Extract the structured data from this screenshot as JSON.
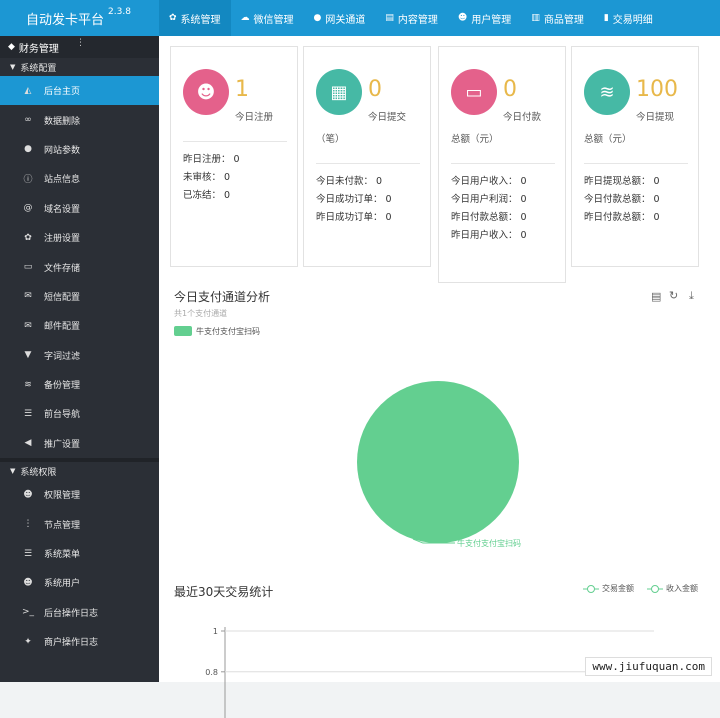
{
  "app": {
    "title": "自动发卡平台",
    "version": "2.3.8"
  },
  "nav": [
    {
      "icon": "gear-icon",
      "glyph": "✿",
      "label": "系统管理",
      "active": true
    },
    {
      "icon": "wechat-icon",
      "glyph": "☁",
      "label": "微信管理"
    },
    {
      "icon": "gateway-icon",
      "glyph": "●",
      "label": "网关通道"
    },
    {
      "icon": "document-icon",
      "glyph": "▤",
      "label": "内容管理"
    },
    {
      "icon": "users-icon",
      "glyph": "☻",
      "label": "用户管理"
    },
    {
      "icon": "shop-icon",
      "glyph": "▥",
      "label": "商品管理"
    },
    {
      "icon": "bar-chart-icon",
      "glyph": "▮",
      "label": "交易明细"
    }
  ],
  "sidebar": {
    "header": "财务管理",
    "groups": [
      {
        "label": "系统配置",
        "items": [
          {
            "icon": "area-chart-icon",
            "glyph": "◭",
            "label": "后台主页",
            "active": true
          },
          {
            "icon": "link-icon",
            "glyph": "∞",
            "label": "数据删除"
          },
          {
            "icon": "apple-icon",
            "glyph": "●",
            "label": "网站参数"
          },
          {
            "icon": "info-icon",
            "glyph": "ⓘ",
            "label": "站点信息"
          },
          {
            "icon": "at-icon",
            "glyph": "@",
            "label": "域名设置"
          },
          {
            "icon": "gear-icon",
            "glyph": "✿",
            "label": "注册设置"
          },
          {
            "icon": "file-icon",
            "glyph": "▭",
            "label": "文件存储"
          },
          {
            "icon": "mail-icon",
            "glyph": "✉",
            "label": "短信配置"
          },
          {
            "icon": "mail-icon",
            "glyph": "✉",
            "label": "邮件配置"
          },
          {
            "icon": "filter-icon",
            "glyph": "▼",
            "label": "字词过滤"
          },
          {
            "icon": "database-icon",
            "glyph": "≋",
            "label": "备份管理"
          },
          {
            "icon": "list-icon",
            "glyph": "☰",
            "label": "前台导航"
          },
          {
            "icon": "bullhorn-icon",
            "glyph": "◀",
            "label": "推广设置"
          }
        ]
      },
      {
        "label": "系统权限",
        "items": [
          {
            "icon": "users-icon",
            "glyph": "☻",
            "label": "权限管理"
          },
          {
            "icon": "more-icon",
            "glyph": "⋮",
            "label": "节点管理"
          },
          {
            "icon": "menu-icon",
            "glyph": "☰",
            "label": "系统菜单"
          },
          {
            "icon": "users-icon",
            "glyph": "☻",
            "label": "系统用户"
          },
          {
            "icon": "terminal-icon",
            "glyph": ">_",
            "label": "后台操作日志"
          },
          {
            "icon": "pin-icon",
            "glyph": "✦",
            "label": "商户操作日志"
          }
        ]
      }
    ]
  },
  "cards": [
    {
      "color": "#e4618b",
      "icon": "users-icon",
      "glyph": "☻",
      "value": "1",
      "label": "今日注册",
      "sub": "",
      "stats": [
        "昨日注册： 0",
        "未审核： 0",
        "已冻结： 0"
      ]
    },
    {
      "color": "#46b9a5",
      "icon": "calendar-icon",
      "glyph": "▦",
      "value": "0",
      "label": "今日提交",
      "sub": "（笔）",
      "stats": [
        "今日未付款： 0",
        "今日成功订单： 0",
        "昨日成功订单： 0"
      ]
    },
    {
      "color": "#e4618b",
      "icon": "credit-card-icon",
      "glyph": "▭",
      "value": "0",
      "label": "今日付款",
      "sub": "总额（元）",
      "stats": [
        "今日用户收入： 0",
        "今日用户利润： 0",
        "昨日付款总额： 0",
        "昨日用户收入： 0"
      ]
    },
    {
      "color": "#46b9a5",
      "icon": "database-icon",
      "glyph": "≋",
      "value": "100",
      "label": "今日提现",
      "sub": "总额（元）",
      "stats": [
        "昨日提现总额： 0",
        "今日付款总额： 0",
        "昨日付款总额： 0"
      ]
    }
  ],
  "pie_section": {
    "title": "今日支付通道分析",
    "subtitle": "共1个支付通道",
    "legend": "牛支付支付宝扫码"
  },
  "trend_section": {
    "title": "最近30天交易统计",
    "legend": [
      "交易金额",
      "收入金额"
    ]
  },
  "chart_data": [
    {
      "type": "pie",
      "title": "今日支付通道分析",
      "subtitle": "共1个支付通道",
      "slices": [
        {
          "name": "牛支付支付宝扫码",
          "value": 1,
          "color": "#63cf90"
        }
      ]
    },
    {
      "type": "line",
      "title": "最近30天交易统计",
      "series": [
        {
          "name": "交易金额",
          "values": []
        },
        {
          "name": "收入金额",
          "values": []
        }
      ],
      "yticks": [
        "1",
        "0.8"
      ],
      "ylim": [
        0,
        1
      ]
    }
  ],
  "watermark": "www.jiufuquan.com"
}
